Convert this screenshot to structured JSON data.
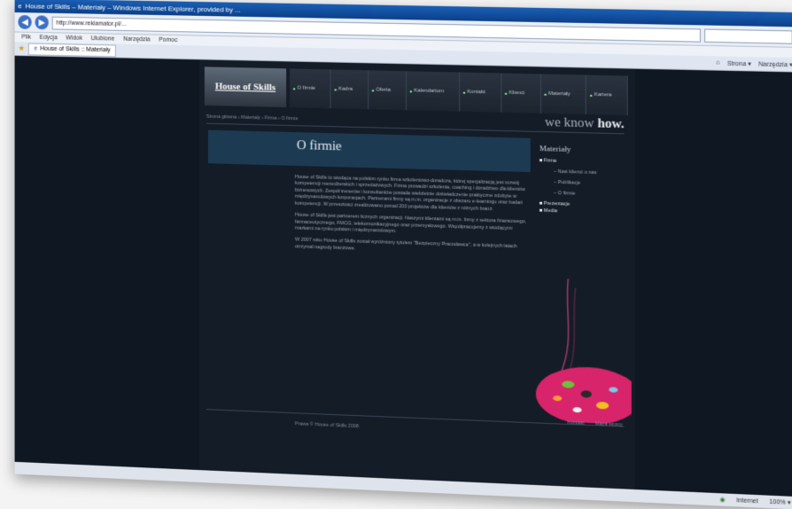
{
  "browser": {
    "title": "House of Skills – Materiały – Windows Internet Explorer, provided by ...",
    "url": "http://www.reklamator.pl/...",
    "menu": [
      "Plik",
      "Edycja",
      "Widok",
      "Ulubione",
      "Narzędzia",
      "Pomoc"
    ],
    "tab_label": "House of Skills :: Materiały",
    "tools": [
      "Strona ▾",
      "Narzędzia ▾"
    ],
    "status_zone": "Internet",
    "zoom": "100% ▾"
  },
  "site": {
    "logo": "House of Skills",
    "nav": [
      "O firmie",
      "Kadra",
      "Oferta",
      "Kalendarium",
      "Kontakt",
      "Klienci",
      "Materiały",
      "Kariera"
    ],
    "breadcrumb": "Strona główna › Materiały › Firma › O firmie",
    "slogan_pre": "we know",
    "slogan_bold": "how.",
    "page_title": "O firmie",
    "paragraphs": [
      "House of Skills to wiodąca na polskim rynku firma szkoleniowo-doradcza, której specjalizacją jest rozwój kompetencji menedżerskich i sprzedażowych. Firma prowadzi szkolenia, coaching i doradztwo dla klientów biznesowych. Zespół trenerów i konsultantów posiada wieloletnie doświadczenie praktyczne zdobyte w międzynarodowych korporacjach. Partnerami firmy są m.in. organizacje z obszaru e-learningu oraz badań kompetencji. W przeszłości zrealizowano ponad 200 projektów dla klientów z różnych branż.",
      "House of Skills jest partnerem licznych organizacji. Naszymi klientami są m.in. firmy z sektora finansowego, farmaceutycznego, FMCG, telekomunikacyjnego oraz przemysłowego. Współpracujemy z wiodącymi markami na rynku polskim i międzynarodowym.",
      "W 2007 roku House of Skills został wyróżniony tytułem \"Bezpieczny Pracodawca\", a w kolejnych latach otrzymał nagrody branżowe."
    ],
    "side_title": "Materiały",
    "side_items": [
      {
        "label": "Firma",
        "level": 1
      },
      {
        "label": "Nasi klienci o nas",
        "level": 2
      },
      {
        "label": "Publikacje",
        "level": 2
      },
      {
        "label": "O firmie",
        "level": 2
      },
      {
        "label": "Prezentacje",
        "level": 1
      },
      {
        "label": "Media",
        "level": 1
      }
    ],
    "footer": "Prawa © House of Skills 2008",
    "footer_links": [
      "Kontakt",
      "Mapa strony"
    ]
  }
}
